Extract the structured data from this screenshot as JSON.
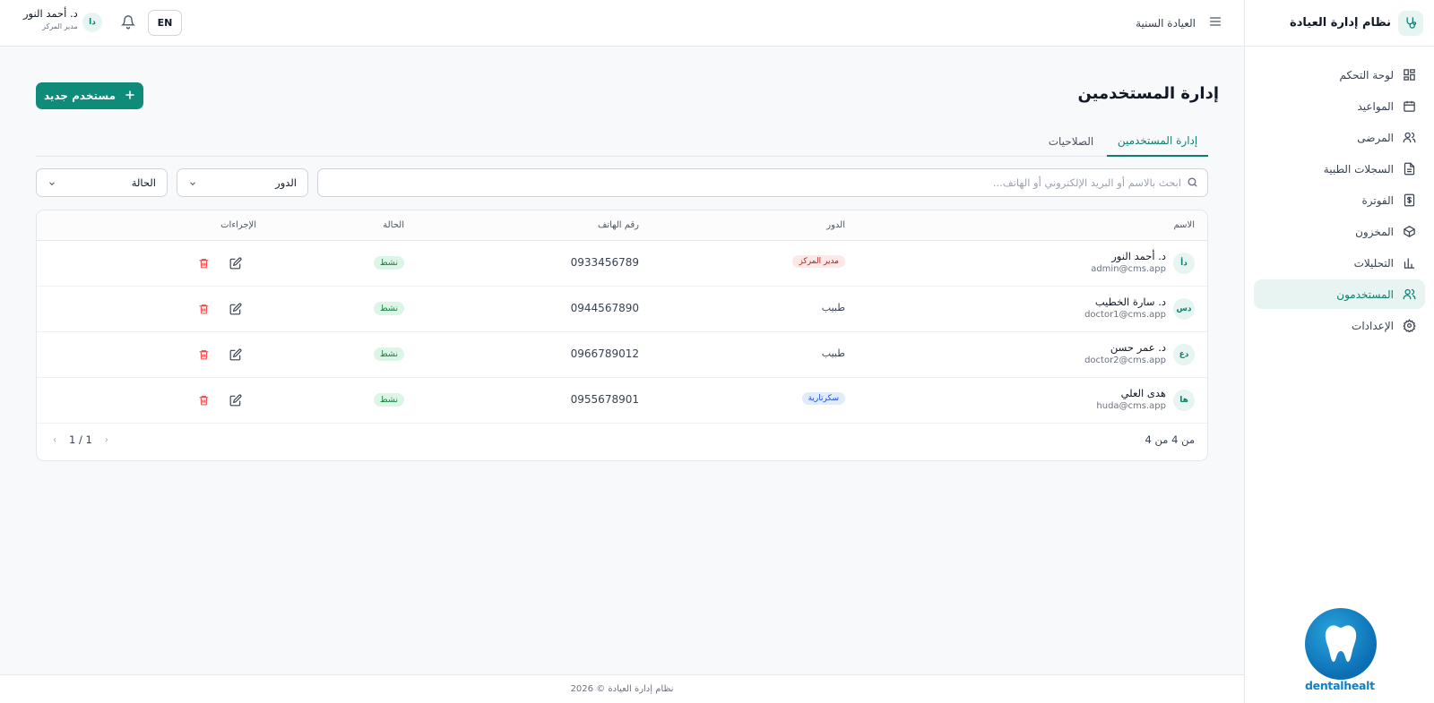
{
  "sidebar": {
    "brand": "نظام إدارة العيادة",
    "items": [
      {
        "label": "لوحة التحكم",
        "icon": "dashboard-icon"
      },
      {
        "label": "المواعيد",
        "icon": "calendar-icon"
      },
      {
        "label": "المرضى",
        "icon": "users-icon"
      },
      {
        "label": "السجلات الطبية",
        "icon": "file-icon"
      },
      {
        "label": "الفوترة",
        "icon": "billing-icon"
      },
      {
        "label": "المخزون",
        "icon": "box-icon"
      },
      {
        "label": "التحليلات",
        "icon": "analytics-icon"
      },
      {
        "label": "المستخدمون",
        "icon": "users-icon",
        "active": true
      },
      {
        "label": "الإعدادات",
        "icon": "gear-icon"
      }
    ],
    "logo_text": "dentalhealt"
  },
  "topbar": {
    "clinic": "العيادة السنية",
    "lang": "EN",
    "user_initials": "دا",
    "user_name": "د. أحمد النور",
    "user_role": "مدير المركز"
  },
  "page": {
    "title": "إدارة المستخدمين",
    "new_button": "مستخدم جديد",
    "tabs": [
      "إدارة المستخدمين",
      "الصلاحيات"
    ],
    "search_placeholder": "ابحث بالاسم أو البريد الإلكتروني أو الهاتف...",
    "role_select": "الدور",
    "status_select": "الحالة"
  },
  "table": {
    "headers": {
      "name": "الاسم",
      "role": "الدور",
      "phone": "رقم الهاتف",
      "status": "الحالة",
      "actions": "الإجراءات"
    },
    "rows": [
      {
        "initials": "دأ",
        "name": "د. أحمد النور",
        "email": "admin@cms.app",
        "role": "مدير المركز",
        "role_style": "red",
        "phone": "0933456789",
        "status": "نشط"
      },
      {
        "initials": "دس",
        "name": "د. سارة الخطيب",
        "email": "doctor1@cms.app",
        "role": "طبيب",
        "role_style": "plain",
        "phone": "0944567890",
        "status": "نشط"
      },
      {
        "initials": "دع",
        "name": "د. عمر حسن",
        "email": "doctor2@cms.app",
        "role": "طبيب",
        "role_style": "plain",
        "phone": "0966789012",
        "status": "نشط"
      },
      {
        "initials": "ها",
        "name": "هدى العلي",
        "email": "huda@cms.app",
        "role": "سكرتارية",
        "role_style": "blue",
        "phone": "0955678901",
        "status": "نشط"
      }
    ],
    "count_text": "من 4 من 4",
    "pager": "1 / 1"
  },
  "footer": "نظام إدارة العيادة © 2026",
  "colors": {
    "accent": "#0f8b7a",
    "active_bg": "#e7f4f1",
    "danger": "#ef4444"
  }
}
